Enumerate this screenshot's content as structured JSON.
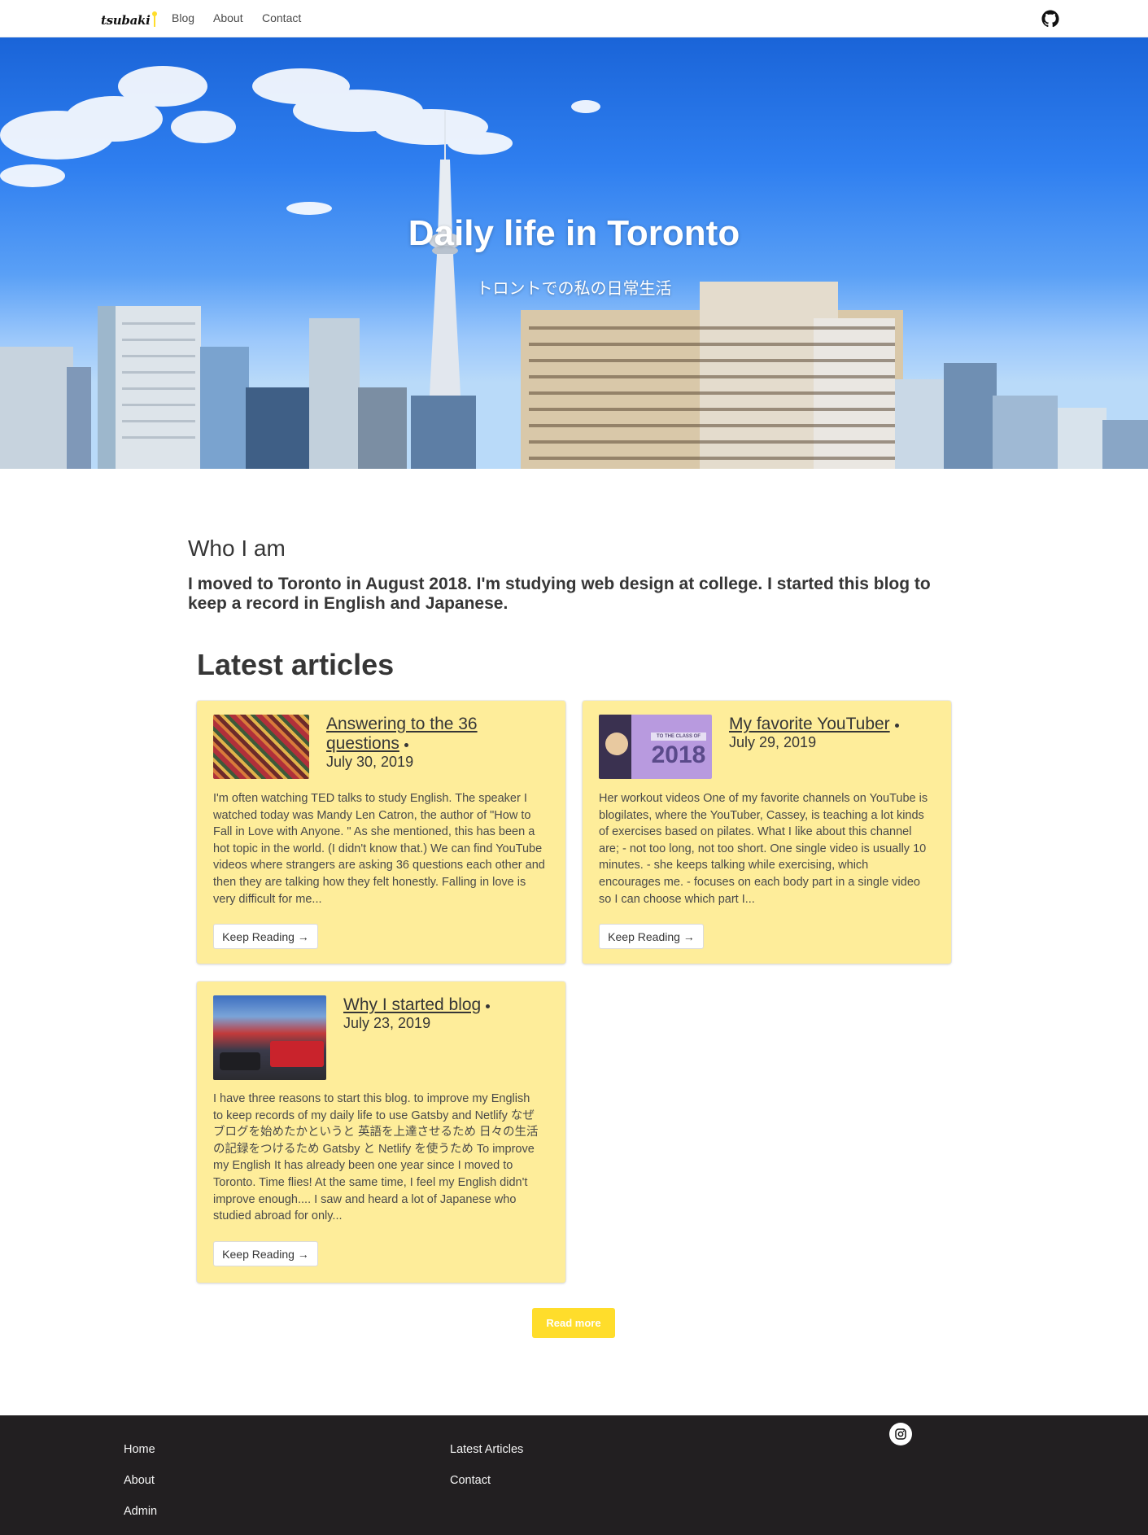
{
  "navbar": {
    "brand": "tsubaki",
    "links": [
      "Blog",
      "About",
      "Contact"
    ],
    "github_icon": "github-icon"
  },
  "hero": {
    "title": "Daily life in Toronto",
    "subtitle": "トロントでの私の日常生活"
  },
  "intro": {
    "heading": "Who I am",
    "text": "I moved to Toronto in August 2018. I'm studying web design at college. I started this blog to keep a record in English and Japanese."
  },
  "latest": {
    "heading": "Latest articles",
    "articles": [
      {
        "title": "Answering to the 36 questions",
        "date": "July 30, 2019",
        "excerpt": "I'm often watching TED talks to study English. The speaker I watched today was Mandy Len Catron, the author of \"How to Fall in Love with Anyone. \" As she mentioned, this has been a hot topic in the world. (I didn't know that.) We can find YouTube videos where strangers are asking 36 questions each other and then they are talking how they felt honestly. Falling in love is very difficult for me...",
        "button": "Keep Reading →"
      },
      {
        "title": "My favorite YouTuber",
        "date": "July 29, 2019",
        "excerpt": "Her workout videos One of my favorite channels on YouTube is blogilates, where the YouTuber, Cassey, is teaching a lot kinds of exercises based on pilates. What I like about this channel are; - not too long, not too short. One single video is usually 10 minutes. - she keeps talking while exercising, which encourages me. - focuses on each body part in a single video so I can choose which part I...",
        "button": "Keep Reading →",
        "thumb_text_small": "TO THE CLASS OF",
        "thumb_text_big": "2018"
      },
      {
        "title": "Why I started blog",
        "date": "July 23, 2019",
        "excerpt": "I have three reasons to start this blog. to improve my English to keep records of my daily life to use Gatsby and Netlify なぜブログを始めたかというと 英語を上達させるため 日々の生活の記録をつけるため Gatsby と Netlify を使うため To improve my English It has already been one year since I moved to Toronto. Time flies! At the same time, I feel my English didn't improve enough.... I saw and heard a lot of Japanese who studied abroad for only...",
        "button": "Keep Reading →"
      }
    ],
    "read_more": "Read more"
  },
  "footer": {
    "col1": [
      "Home",
      "About",
      "Admin"
    ],
    "col2": [
      "Latest Articles",
      "Contact"
    ],
    "instagram_icon": "instagram-icon"
  },
  "colors": {
    "card_bg": "#feed9a",
    "accent": "#ffdd2b",
    "footer_bg": "#221f21",
    "text": "#363636"
  }
}
